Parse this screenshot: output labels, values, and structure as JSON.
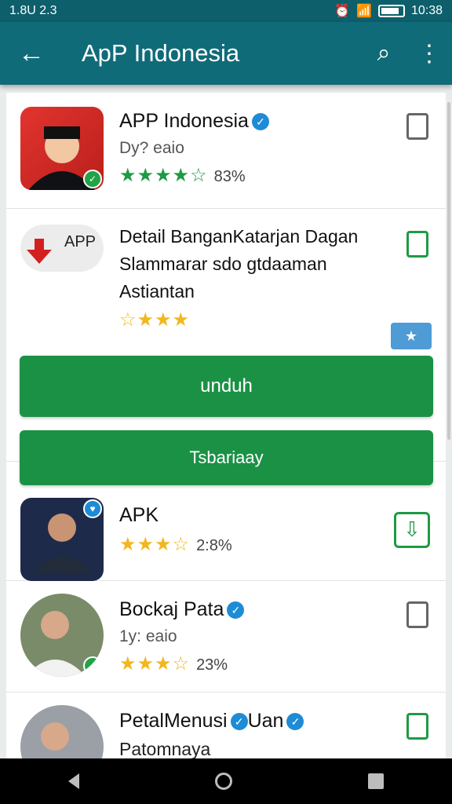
{
  "status": {
    "left": "1.8U 2.3",
    "time": "10:38"
  },
  "appbar": {
    "title": "ApP Indonesia"
  },
  "apps": [
    {
      "name": "APP Indonesia",
      "sub": "Dy? eaio",
      "stars": "★★★★☆",
      "pct": "83%",
      "star_color": "#1f9a44"
    },
    {
      "title": "Detail BanganKatarjan Dagan",
      "line2": "Slammarar sdo gtdaaman",
      "line3": "Astiantan",
      "stars": "☆★★★"
    },
    {
      "name": "APK",
      "stars": "★★★☆",
      "pct": "2:8%",
      "star_color": "#f2b71f"
    },
    {
      "name": "Bockaj Pata",
      "sub": "1y: eaio",
      "stars": "★★★☆",
      "pct": "23%",
      "star_color": "#f2b71f"
    },
    {
      "name": "PetalMenusi",
      "name2": "Uan",
      "sub": "Patomnaya"
    }
  ],
  "buttons": {
    "download": "unduh",
    "secondary": "Tsbariaay"
  },
  "colors": {
    "appbar": "#0f6b78",
    "status": "#0d5f6b",
    "green": "#1b9145",
    "verify": "#1e8bd6"
  },
  "icons": [
    "back-arrow-icon",
    "search-icon",
    "more-vert-icon",
    "bookmark-icon",
    "download-icon",
    "badge-icon",
    "nav-back-icon",
    "nav-home-icon",
    "nav-recent-icon"
  ]
}
